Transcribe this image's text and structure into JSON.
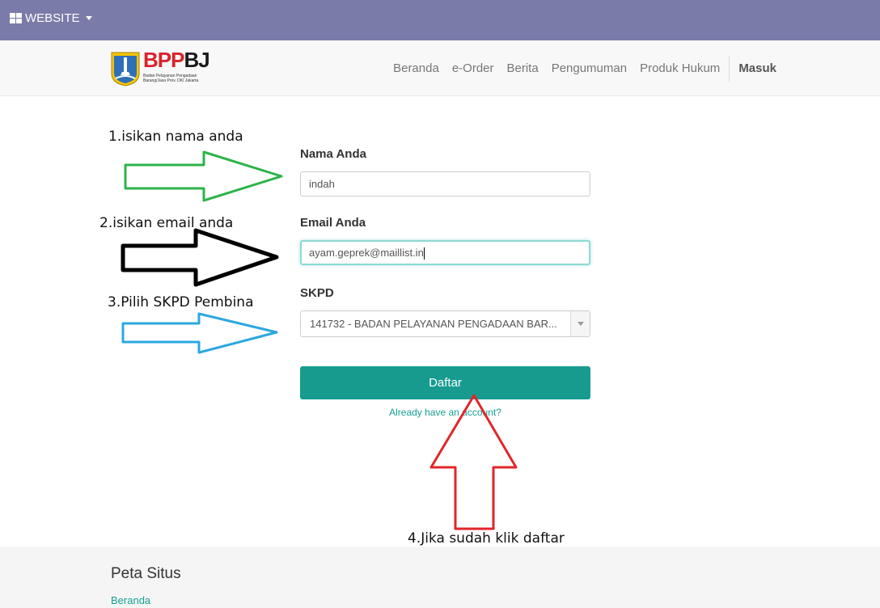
{
  "topbar": {
    "website_label": "WEBSITE"
  },
  "logo": {
    "title_part1": "BPP",
    "title_part2": "BJ",
    "subtitle": "Badan Pelayanan Pengadaan\nBarang/Jasa Prov. DKI Jakarta"
  },
  "nav": {
    "items": [
      "Beranda",
      "e-Order",
      "Berita",
      "Pengumuman",
      "Produk Hukum"
    ],
    "login": "Masuk"
  },
  "form": {
    "name_label": "Nama Anda",
    "name_value": "indah",
    "email_label": "Email Anda",
    "email_value": "ayam.geprek@maillist.in",
    "skpd_label": "SKPD",
    "skpd_value": "141732 - BADAN PELAYANAN PENGADAAN BAR...",
    "submit_label": "Daftar",
    "login_link": "Already have an account?"
  },
  "annotations": {
    "step1": "1.isikan nama anda",
    "step2": "2.isikan email anda",
    "step3": "3.Pilih SKPD Pembina",
    "step4": "4.Jika sudah klik daftar"
  },
  "footer": {
    "title": "Peta Situs",
    "link": "Beranda"
  },
  "colors": {
    "topbar": "#7b7ba9",
    "primary": "#179b8f",
    "arrow_green": "#2db34a",
    "arrow_black": "#000000",
    "arrow_blue": "#2aa8e0",
    "arrow_red": "#e0262b"
  }
}
